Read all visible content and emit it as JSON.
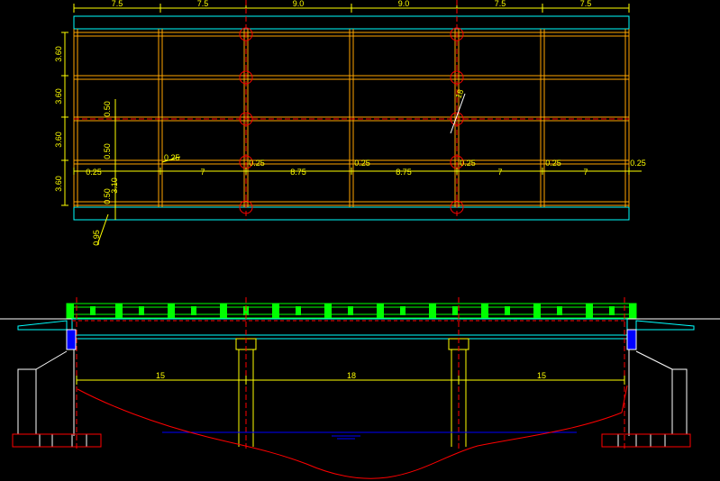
{
  "plan": {
    "top_dims": [
      "7.5",
      "7.5",
      "9.0",
      "9.0",
      "7.5",
      "7.5"
    ],
    "left_dims": [
      "3.60",
      "3.60",
      "3.60",
      "3.60"
    ],
    "small_dims": {
      "d050a": "0.50",
      "d050b": "0.50",
      "d050c": "0.50",
      "d310": "3.10",
      "d095": "0.95",
      "d025_left": "0.25",
      "d025_top": "0.25"
    },
    "bottom_dims": [
      "0.25",
      "7",
      "0.25",
      "8.75",
      "0.25",
      "8.75",
      "0.25",
      "7",
      "0.25",
      "7",
      "0.25"
    ],
    "skew_label": "18"
  },
  "elevation": {
    "span_dims": [
      "15",
      "18",
      "15"
    ]
  },
  "colors": {
    "background": "#000000",
    "dimension": "#ffff00",
    "beam": "#ffa500",
    "deck": "#00ffff",
    "railing": "#00ff00",
    "centerline": "#ff0000",
    "water": "#0000ff",
    "structure": "#ffffff"
  }
}
